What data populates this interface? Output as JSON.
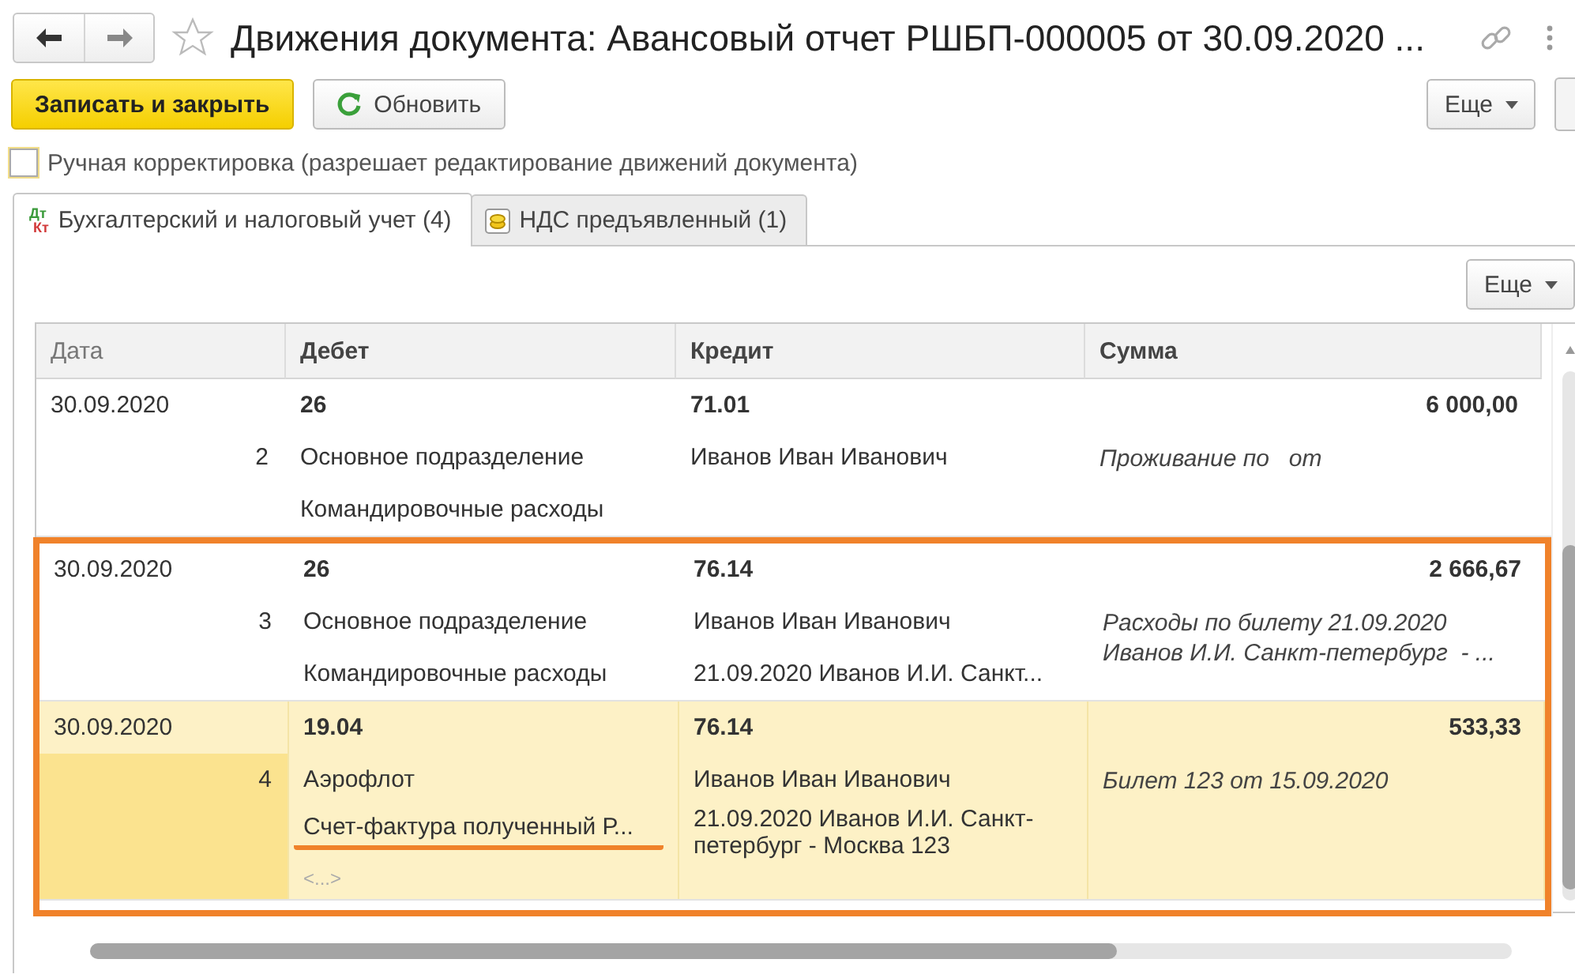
{
  "window": {
    "title": "Движения документа: Авансовый отчет РШБП-000005 от 30.09.2020 ..."
  },
  "toolbar": {
    "buttons": [
      {
        "label": "Записать и закрыть",
        "kind": "primary"
      },
      {
        "label": "Обновить",
        "kind": "refresh"
      }
    ],
    "more": "Еще"
  },
  "manual_edit": {
    "label": "Ручная корректировка (разрешает редактирование движений документа)",
    "checked": false
  },
  "tabs": [
    {
      "label": "Бухгалтерский и налоговый учет (4)",
      "selected": true,
      "kind": "accounting",
      "icon_top": "Дт",
      "icon_bottom": "Кт"
    },
    {
      "label": "НДС предъявленный (1)",
      "selected": false,
      "kind": "vat"
    }
  ],
  "table": {
    "more": "Еще",
    "columns": [
      "Дата",
      "Дебет",
      "Кредит",
      "Сумма"
    ],
    "rows": [
      {
        "date": "30.09.2020",
        "number": "2",
        "selected": false,
        "highlighted": false,
        "debit": [
          {
            "text": "26",
            "kind": "account",
            "underlined": false
          },
          {
            "text": "Основное подразделение",
            "kind": "text",
            "underlined": false
          },
          {
            "text": "Командировочные расходы",
            "kind": "text",
            "underlined": false
          }
        ],
        "credit": [
          {
            "text": "71.01",
            "kind": "account"
          },
          {
            "text": "Иванов Иван Иванович",
            "kind": "text"
          }
        ],
        "amount": "6 000,00",
        "content": "Проживание по   от"
      },
      {
        "date": "30.09.2020",
        "number": "3",
        "selected": false,
        "highlighted": true,
        "debit": [
          {
            "text": "26",
            "kind": "account",
            "underlined": false
          },
          {
            "text": "Основное подразделение",
            "kind": "text",
            "underlined": false
          },
          {
            "text": "Командировочные расходы",
            "kind": "text",
            "underlined": false
          }
        ],
        "credit": [
          {
            "text": "76.14",
            "kind": "account"
          },
          {
            "text": "Иванов Иван Иванович",
            "kind": "text"
          },
          {
            "text": "21.09.2020 Иванов И.И. Санкт...",
            "kind": "text"
          }
        ],
        "amount": "2 666,67",
        "content": "Расходы по билету 21.09.2020 Иванов И.И. Санкт-петербург  - ..."
      },
      {
        "date": "30.09.2020",
        "number": "4",
        "selected": true,
        "highlighted": true,
        "debit": [
          {
            "text": "19.04",
            "kind": "account",
            "underlined": false
          },
          {
            "text": "Аэрофлот",
            "kind": "text",
            "underlined": false
          },
          {
            "text": "Счет-фактура полученный Р...",
            "kind": "text",
            "underlined": true
          },
          {
            "text": "<...>",
            "kind": "empty",
            "underlined": false
          }
        ],
        "credit": [
          {
            "text": "76.14",
            "kind": "account"
          },
          {
            "text": "Иванов Иван Иванович",
            "kind": "text"
          },
          {
            "text": "21.09.2020 Иванов И.И. Санкт-петербург  - Москва 123",
            "kind": "text"
          }
        ],
        "amount": "533,33",
        "content": "Билет 123 от 15.09.2020"
      }
    ]
  }
}
